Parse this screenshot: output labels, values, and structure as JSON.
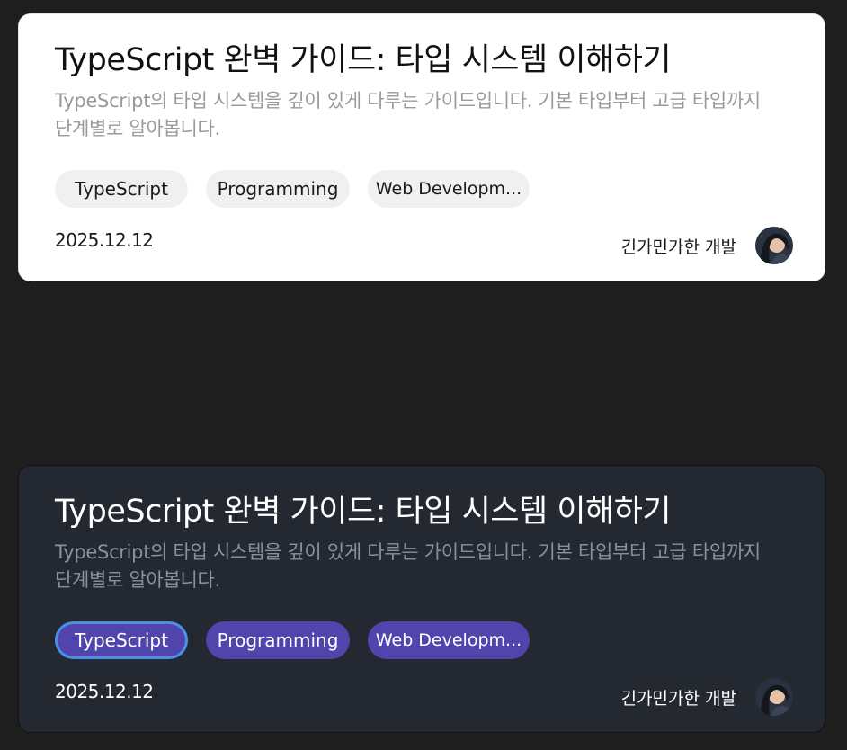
{
  "cards": [
    {
      "theme": "light",
      "title": "TypeScript 완벽 가이드: 타입 시스템 이해하기",
      "description": "TypeScript의 타입 시스템을 깊이 있게 다루는 가이드입니다. 기본 타입부터 고급 타입까지 단계별로 알아봅니다.",
      "tags": [
        "TypeScript",
        "Programming",
        "Web Developm..."
      ],
      "date": "2025.12.12",
      "author": "긴가민가한 개발",
      "avatar_icon": "user-avatar"
    },
    {
      "theme": "dark",
      "focused_tag": 0,
      "title": "TypeScript 완벽 가이드: 타입 시스템 이해하기",
      "description": "TypeScript의 타입 시스템을 깊이 있게 다루는 가이드입니다. 기본 타입부터 고급 타입까지 단계별로 알아봅니다.",
      "tags": [
        "TypeScript",
        "Programming",
        "Web Developm..."
      ],
      "date": "2025.12.12",
      "author": "긴가민가한 개발",
      "avatar_icon": "user-avatar"
    }
  ],
  "colors": {
    "page_background": "#1e1e1e",
    "light_card": "#ffffff",
    "dark_card": "#232831",
    "dark_tag": "#5145ad",
    "focus_ring": "#4a90e8"
  }
}
